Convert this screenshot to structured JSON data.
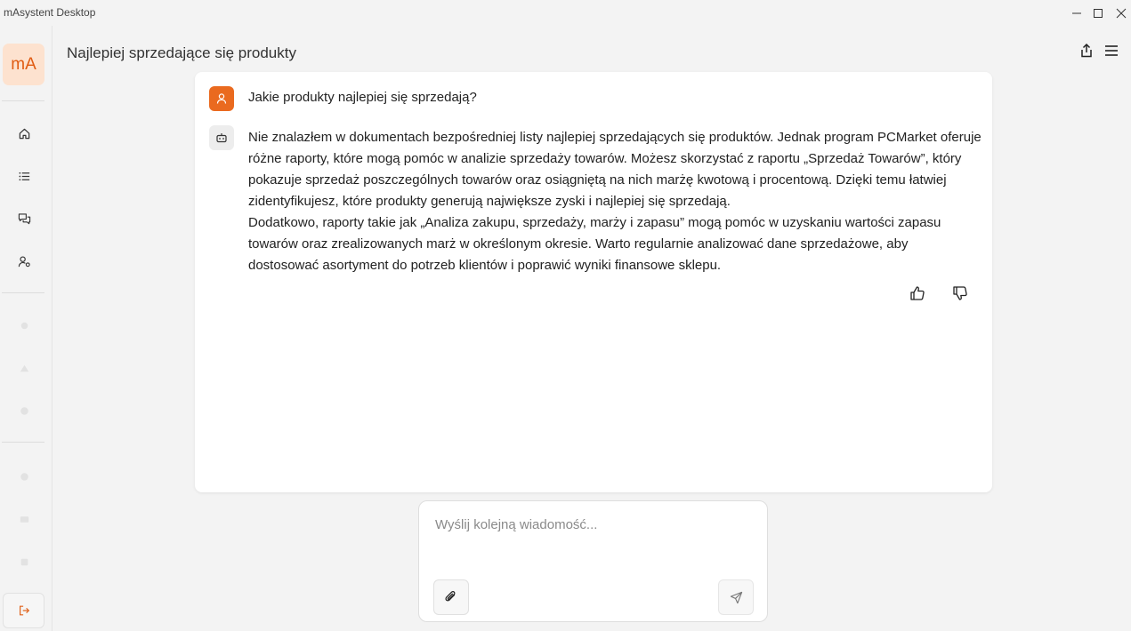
{
  "window": {
    "title": "mAsystent Desktop"
  },
  "sidebar": {
    "logo": "mA",
    "nav_items": [
      {
        "name": "home",
        "icon": "home-icon"
      },
      {
        "name": "list",
        "icon": "list-icon"
      },
      {
        "name": "chats",
        "icon": "chat-icon"
      },
      {
        "name": "users",
        "icon": "user-settings-icon"
      }
    ],
    "logout_icon": "logout-icon"
  },
  "header": {
    "title": "Najlepiej sprzedające się produkty",
    "share_icon": "share-icon",
    "menu_icon": "menu-icon"
  },
  "conversation": {
    "user_message": "Jakie produkty najlepiej się sprzedają?",
    "bot_paragraphs": [
      "Nie znalazłem w dokumentach bezpośredniej listy najlepiej sprzedających się produktów. Jednak program PCMarket oferuje różne raporty, które mogą pomóc w analizie sprzedaży towarów. Możesz skorzystać z raportu „Sprzedaż Towarów”, który pokazuje sprzedaż poszczególnych towarów oraz osiągniętą na nich marżę kwotową i procentową. Dzięki temu łatwiej zidentyfikujesz, które produkty generują największe zyski i najlepiej się sprzedają.",
      "Dodatkowo, raporty takie jak „Analiza zakupu, sprzedaży, marży i zapasu” mogą pomóc w uzyskaniu wartości zapasu towarów oraz zrealizowanych marż w określonym okresie. Warto regularnie analizować dane sprzedażowe, aby dostosować asortyment do potrzeb klientów i poprawić wyniki finansowe sklepu."
    ]
  },
  "composer": {
    "placeholder": "Wyślij kolejną wiadomość...",
    "value": ""
  },
  "colors": {
    "accent": "#ea6a1f",
    "logo_bg": "#fde2cf",
    "background": "#f3f3f3",
    "card": "#ffffff"
  }
}
